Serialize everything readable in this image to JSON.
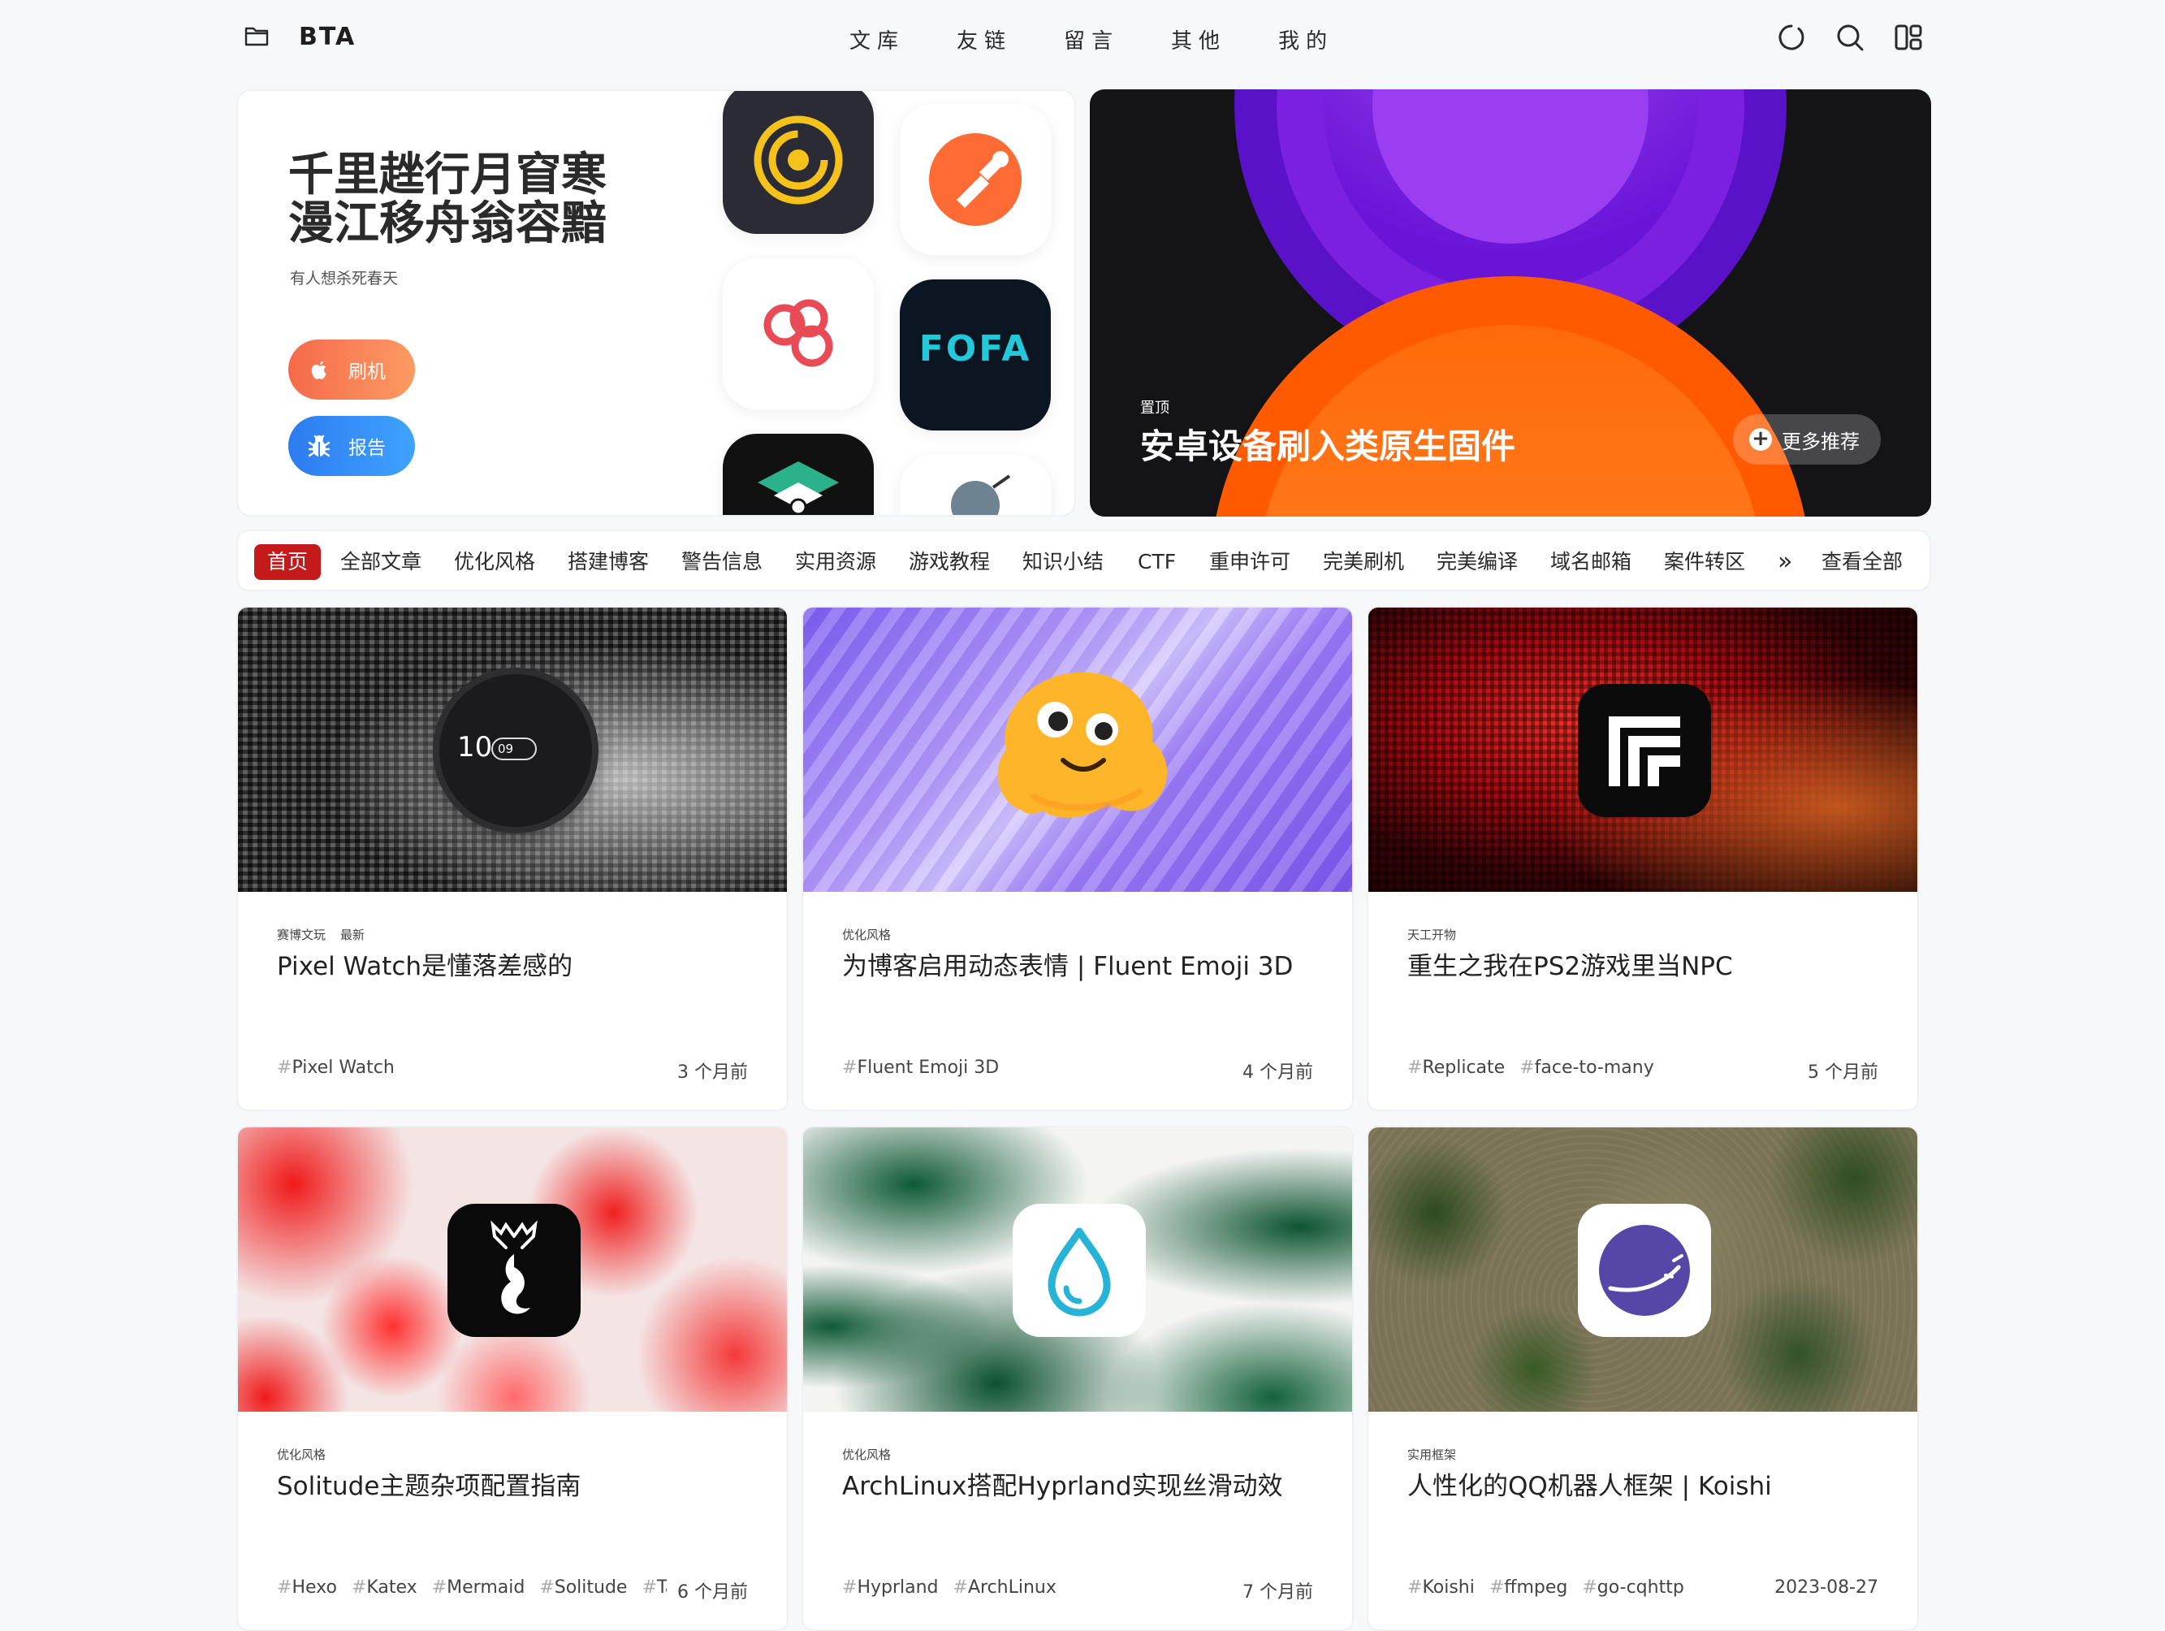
{
  "nav": {
    "logo": "BTA",
    "menu": [
      "文库",
      "友链",
      "留言",
      "其他",
      "我的"
    ]
  },
  "hero": {
    "title_line1": "千里趖行月窅寒",
    "title_line2": "漫江移舟翁容黯",
    "subtitle": "有人想杀死春天",
    "btn_flash": "刷机",
    "btn_report": "报告",
    "fofa_label": "FOFA",
    "banner_tag": "置顶",
    "banner_title": "安卓设备刷入类原生固件",
    "more_label": "更多推荐"
  },
  "categories": [
    "首页",
    "全部文章",
    "优化风格",
    "搭建博客",
    "警告信息",
    "实用资源",
    "游戏教程",
    "知识小结",
    "CTF",
    "重申许可",
    "完美刷机",
    "完美编译",
    "域名邮箱",
    "案件转区",
    "»",
    "查看全部"
  ],
  "cards": [
    {
      "cat": "赛博文玩",
      "badge": "最新",
      "title": "Pixel Watch是懂落差感的",
      "tags": [
        "Pixel Watch"
      ],
      "date": "3 个月前",
      "watch_hour": "10",
      "watch_date": "09"
    },
    {
      "cat": "优化风格",
      "badge": "",
      "title": "为博客启用动态表情 | Fluent Emoji 3D",
      "tags": [
        "Fluent Emoji 3D"
      ],
      "date": "4 个月前"
    },
    {
      "cat": "天工开物",
      "badge": "",
      "title": "重生之我在PS2游戏里当NPC",
      "tags": [
        "Replicate",
        "face-to-many"
      ],
      "date": "5 个月前"
    },
    {
      "cat": "优化风格",
      "badge": "",
      "title": "Solitude主题杂项配置指南",
      "tags": [
        "Hexo",
        "Katex",
        "Mermaid",
        "Solitude",
        "Ta"
      ],
      "date": "6 个月前"
    },
    {
      "cat": "优化风格",
      "badge": "",
      "title": "ArchLinux搭配Hyprland实现丝滑动效",
      "tags": [
        "Hyprland",
        "ArchLinux"
      ],
      "date": "7 个月前"
    },
    {
      "cat": "实用框架",
      "badge": "",
      "title": "人性化的QQ机器人框架 | Koishi",
      "tags": [
        "Koishi",
        "ffmpeg",
        "go-cqhttp"
      ],
      "date": "2023-08-27"
    }
  ],
  "colors": {
    "active_category": "#c41a1a",
    "flash_button": "#f56a4a",
    "report_button": "#2d7bf0",
    "banner_purple": "#8b2be8",
    "banner_orange": "#ff6a0a"
  }
}
